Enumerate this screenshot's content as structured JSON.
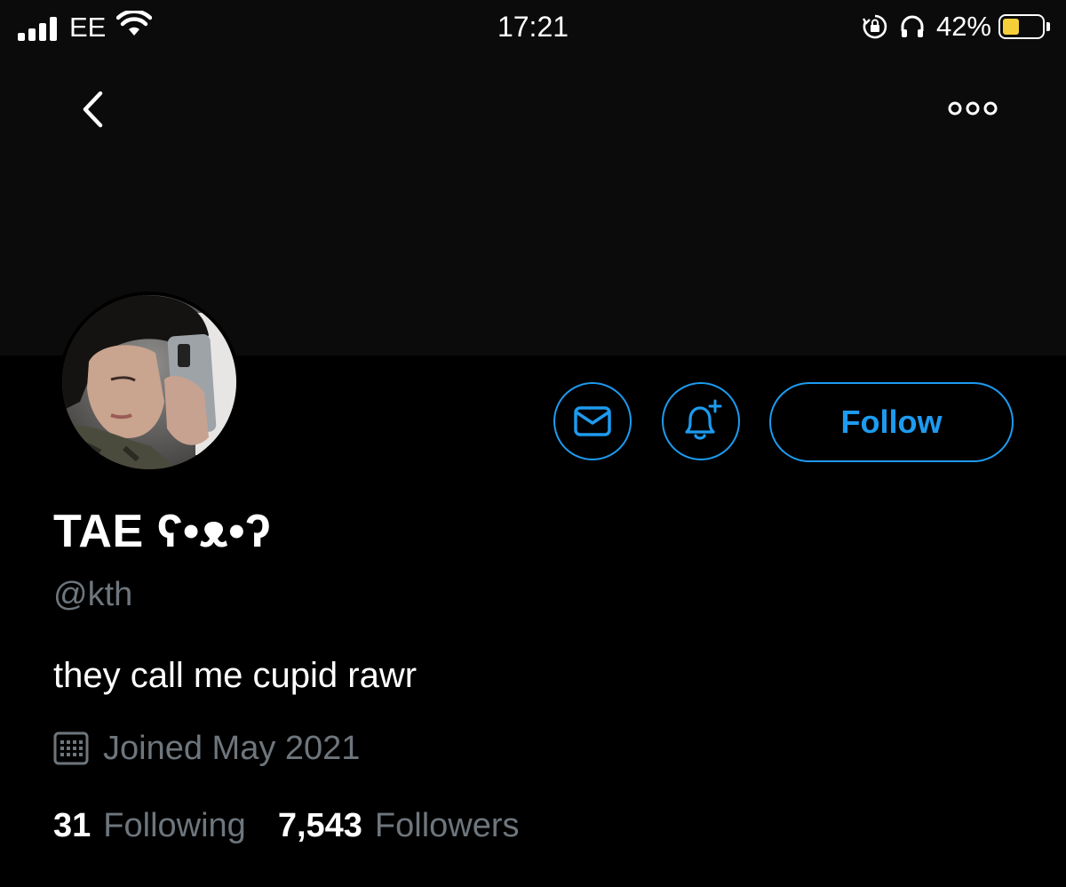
{
  "status_bar": {
    "carrier": "EE",
    "time": "17:21",
    "battery_percent_label": "42%",
    "battery_level": 0.42,
    "battery_color": "#f5cf3a"
  },
  "nav": {
    "back_icon": "chevron-left-icon",
    "more_icon": "more-horizontal-icon"
  },
  "profile": {
    "display_name": "TAE ʕ•ᴥ•ʔ",
    "handle": "@kth",
    "bio": "they call me cupid rawr",
    "joined": "Joined May 2021"
  },
  "actions": {
    "message_icon": "envelope-icon",
    "notify_icon": "bell-plus-icon",
    "follow_label": "Follow"
  },
  "stats": {
    "following_count": "31",
    "following_label": "Following",
    "followers_count": "7,543",
    "followers_label": "Followers"
  },
  "colors": {
    "accent": "#1d9bf0",
    "background": "#000000",
    "secondary_text": "#6e767d"
  }
}
